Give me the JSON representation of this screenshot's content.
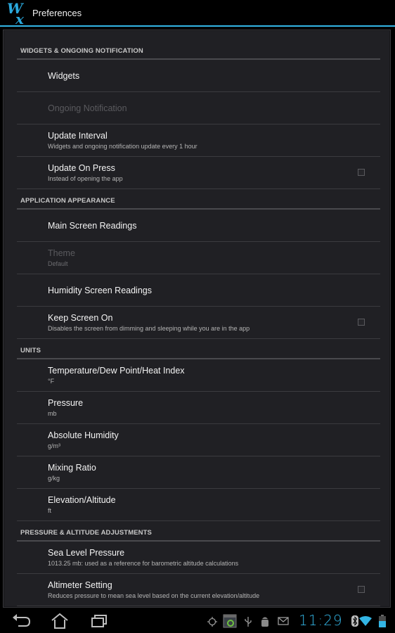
{
  "actionbar": {
    "title": "Preferences",
    "logo_icon": "wx-logo-icon",
    "accent_color": "#33b5e5"
  },
  "sections": [
    {
      "header": "WIDGETS & ONGOING NOTIFICATION",
      "items": [
        {
          "title": "Widgets",
          "summary": "",
          "enabled": true,
          "checkbox": false
        },
        {
          "title": "Ongoing Notification",
          "summary": "",
          "enabled": false,
          "checkbox": false
        },
        {
          "title": "Update Interval",
          "summary": "Widgets and ongoing notification update every 1 hour",
          "enabled": true,
          "checkbox": false
        },
        {
          "title": "Update On Press",
          "summary": "Instead of opening the app",
          "enabled": true,
          "checkbox": true,
          "checked": false
        }
      ]
    },
    {
      "header": "APPLICATION APPEARANCE",
      "items": [
        {
          "title": "Main Screen Readings",
          "summary": "",
          "enabled": true,
          "checkbox": false
        },
        {
          "title": "Theme",
          "summary": "Default",
          "enabled": false,
          "checkbox": false
        },
        {
          "title": "Humidity Screen Readings",
          "summary": "",
          "enabled": true,
          "checkbox": false
        },
        {
          "title": "Keep Screen On",
          "summary": "Disables the screen from dimming and sleeping while you are in the app",
          "enabled": true,
          "checkbox": true,
          "checked": false
        }
      ]
    },
    {
      "header": "UNITS",
      "items": [
        {
          "title": "Temperature/Dew Point/Heat Index",
          "summary": "°F",
          "enabled": true,
          "checkbox": false
        },
        {
          "title": "Pressure",
          "summary": "mb",
          "enabled": true,
          "checkbox": false
        },
        {
          "title": "Absolute Humidity",
          "summary": "g/m³",
          "enabled": true,
          "checkbox": false
        },
        {
          "title": "Mixing Ratio",
          "summary": "g/kg",
          "enabled": true,
          "checkbox": false
        },
        {
          "title": "Elevation/Altitude",
          "summary": "ft",
          "enabled": true,
          "checkbox": false
        }
      ]
    },
    {
      "header": "PRESSURE & ALTITUDE ADJUSTMENTS",
      "items": [
        {
          "title": "Sea Level Pressure",
          "summary": "1013.25 mb: used as a reference for barometric altitude calculations",
          "enabled": true,
          "checkbox": false
        },
        {
          "title": "Altimeter Setting",
          "summary": "Reduces pressure to mean sea level based on the current elevation/altitude",
          "enabled": true,
          "checkbox": true,
          "checked": false
        }
      ]
    }
  ],
  "navbar": {
    "buttons": [
      "back-icon",
      "home-icon",
      "recent-apps-icon"
    ]
  },
  "statusbar": {
    "time": "11:29",
    "icons": [
      "gps-icon",
      "app-notification-icon",
      "usb-icon",
      "android-debug-icon",
      "gmail-icon",
      "bluetooth-icon",
      "wifi-icon",
      "battery-icon"
    ]
  }
}
